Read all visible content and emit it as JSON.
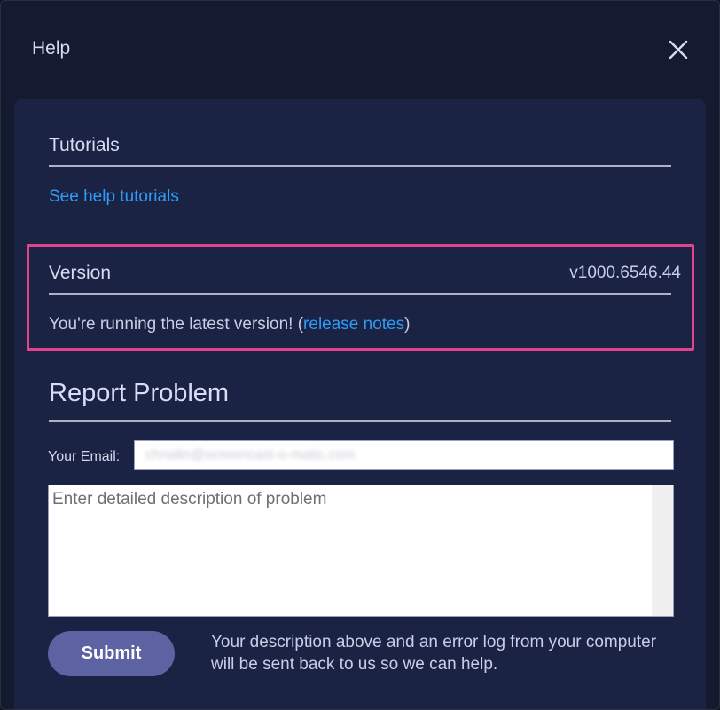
{
  "dialog": {
    "title": "Help"
  },
  "tutorials": {
    "heading": "Tutorials",
    "link_label": "See help tutorials"
  },
  "version": {
    "heading": "Version",
    "number": "v1000.6546.44",
    "status_prefix": "You're running the latest version! (",
    "release_notes_label": "release notes",
    "status_suffix": ")"
  },
  "report": {
    "heading": "Report Problem",
    "email_label": "Your Email:",
    "email_value": "chnalin@screencast-o-matic.com",
    "description_placeholder": "Enter detailed description of problem",
    "submit_label": "Submit",
    "note": "Your description above and an error log from your computer will be sent back to us so we can help."
  },
  "icons": {
    "close": "close-icon"
  },
  "colors": {
    "background": "#141a30",
    "panel": "#1b2345",
    "link": "#2f9bf4",
    "highlight_border": "#e3428e",
    "submit_button": "#5d63a2"
  }
}
